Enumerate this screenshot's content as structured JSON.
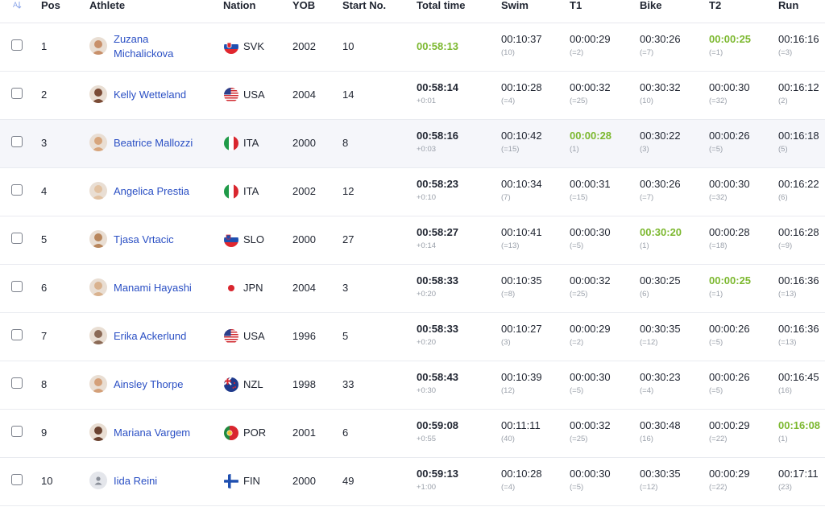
{
  "header": {
    "pos": "Pos",
    "athlete": "Athlete",
    "nation": "Nation",
    "yob": "YOB",
    "start_no": "Start No.",
    "total_time": "Total time",
    "swim": "Swim",
    "t1": "T1",
    "bike": "Bike",
    "t2": "T2",
    "run": "Run",
    "sort_icon": "sort-alpha-icon"
  },
  "colors": {
    "link": "#2a4fc4",
    "best": "#7cb82f",
    "muted": "#9aa0aa",
    "row_highlight": "#f5f6fa"
  },
  "rows": [
    {
      "pos": "1",
      "name_line1": "Zuzana",
      "name_line2": "Michalickova",
      "flag": "svk",
      "nation": "SVK",
      "yob": "2002",
      "start_no": "10",
      "total": "00:58:13",
      "total_sub": "",
      "total_best": true,
      "swim": "00:10:37",
      "swim_rank": "(10)",
      "t1": "00:00:29",
      "t1_rank": "(=2)",
      "bike": "00:30:26",
      "bike_rank": "(=7)",
      "t2": "00:00:25",
      "t2_rank": "(=1)",
      "run": "00:16:16",
      "run_rank": "(=3)"
    },
    {
      "pos": "2",
      "name_line1": "Kelly Wetteland",
      "name_line2": "",
      "flag": "usa",
      "nation": "USA",
      "yob": "2004",
      "start_no": "14",
      "total": "00:58:14",
      "total_sub": "+0:01",
      "swim": "00:10:28",
      "swim_rank": "(=4)",
      "t1": "00:00:32",
      "t1_rank": "(=25)",
      "bike": "00:30:32",
      "bike_rank": "(10)",
      "t2": "00:00:30",
      "t2_rank": "(=32)",
      "run": "00:16:12",
      "run_rank": "(2)"
    },
    {
      "pos": "3",
      "name_line1": "Beatrice Mallozzi",
      "name_line2": "",
      "flag": "ita",
      "nation": "ITA",
      "yob": "2000",
      "start_no": "8",
      "total": "00:58:16",
      "total_sub": "+0:03",
      "swim": "00:10:42",
      "swim_rank": "(=15)",
      "t1": "00:00:28",
      "t1_rank": "(1)",
      "bike": "00:30:22",
      "bike_rank": "(3)",
      "t2": "00:00:26",
      "t2_rank": "(=5)",
      "run": "00:16:18",
      "run_rank": "(5)"
    },
    {
      "pos": "4",
      "name_line1": "Angelica Prestia",
      "name_line2": "",
      "flag": "ita",
      "nation": "ITA",
      "yob": "2002",
      "start_no": "12",
      "total": "00:58:23",
      "total_sub": "+0:10",
      "swim": "00:10:34",
      "swim_rank": "(7)",
      "t1": "00:00:31",
      "t1_rank": "(=15)",
      "bike": "00:30:26",
      "bike_rank": "(=7)",
      "t2": "00:00:30",
      "t2_rank": "(=32)",
      "run": "00:16:22",
      "run_rank": "(6)"
    },
    {
      "pos": "5",
      "name_line1": "Tjasa Vrtacic",
      "name_line2": "",
      "flag": "slo",
      "nation": "SLO",
      "yob": "2000",
      "start_no": "27",
      "total": "00:58:27",
      "total_sub": "+0:14",
      "swim": "00:10:41",
      "swim_rank": "(=13)",
      "t1": "00:00:30",
      "t1_rank": "(=5)",
      "bike": "00:30:20",
      "bike_rank": "(1)",
      "t2": "00:00:28",
      "t2_rank": "(=18)",
      "run": "00:16:28",
      "run_rank": "(=9)"
    },
    {
      "pos": "6",
      "name_line1": "Manami Hayashi",
      "name_line2": "",
      "flag": "jpn",
      "nation": "JPN",
      "yob": "2004",
      "start_no": "3",
      "total": "00:58:33",
      "total_sub": "+0:20",
      "swim": "00:10:35",
      "swim_rank": "(=8)",
      "t1": "00:00:32",
      "t1_rank": "(=25)",
      "bike": "00:30:25",
      "bike_rank": "(6)",
      "t2": "00:00:25",
      "t2_rank": "(=1)",
      "run": "00:16:36",
      "run_rank": "(=13)"
    },
    {
      "pos": "7",
      "name_line1": "Erika Ackerlund",
      "name_line2": "",
      "flag": "usa",
      "nation": "USA",
      "yob": "1996",
      "start_no": "5",
      "total": "00:58:33",
      "total_sub": "+0:20",
      "swim": "00:10:27",
      "swim_rank": "(3)",
      "t1": "00:00:29",
      "t1_rank": "(=2)",
      "bike": "00:30:35",
      "bike_rank": "(=12)",
      "t2": "00:00:26",
      "t2_rank": "(=5)",
      "run": "00:16:36",
      "run_rank": "(=13)"
    },
    {
      "pos": "8",
      "name_line1": "Ainsley Thorpe",
      "name_line2": "",
      "flag": "nzl",
      "nation": "NZL",
      "yob": "1998",
      "start_no": "33",
      "total": "00:58:43",
      "total_sub": "+0:30",
      "swim": "00:10:39",
      "swim_rank": "(12)",
      "t1": "00:00:30",
      "t1_rank": "(=5)",
      "bike": "00:30:23",
      "bike_rank": "(=4)",
      "t2": "00:00:26",
      "t2_rank": "(=5)",
      "run": "00:16:45",
      "run_rank": "(16)"
    },
    {
      "pos": "9",
      "name_line1": "Mariana Vargem",
      "name_line2": "",
      "flag": "por",
      "nation": "POR",
      "yob": "2001",
      "start_no": "6",
      "total": "00:59:08",
      "total_sub": "+0:55",
      "swim": "00:11:11",
      "swim_rank": "(40)",
      "t1": "00:00:32",
      "t1_rank": "(=25)",
      "bike": "00:30:48",
      "bike_rank": "(16)",
      "t2": "00:00:29",
      "t2_rank": "(=22)",
      "run": "00:16:08",
      "run_rank": "(1)"
    },
    {
      "pos": "10",
      "name_line1": "Iida Reini",
      "name_line2": "",
      "flag": "fin",
      "nation": "FIN",
      "yob": "2000",
      "start_no": "49",
      "total": "00:59:13",
      "total_sub": "+1:00",
      "swim": "00:10:28",
      "swim_rank": "(=4)",
      "t1": "00:00:30",
      "t1_rank": "(=5)",
      "bike": "00:30:35",
      "bike_rank": "(=12)",
      "t2": "00:00:29",
      "t2_rank": "(=22)",
      "run": "00:17:11",
      "run_rank": "(23)"
    }
  ]
}
